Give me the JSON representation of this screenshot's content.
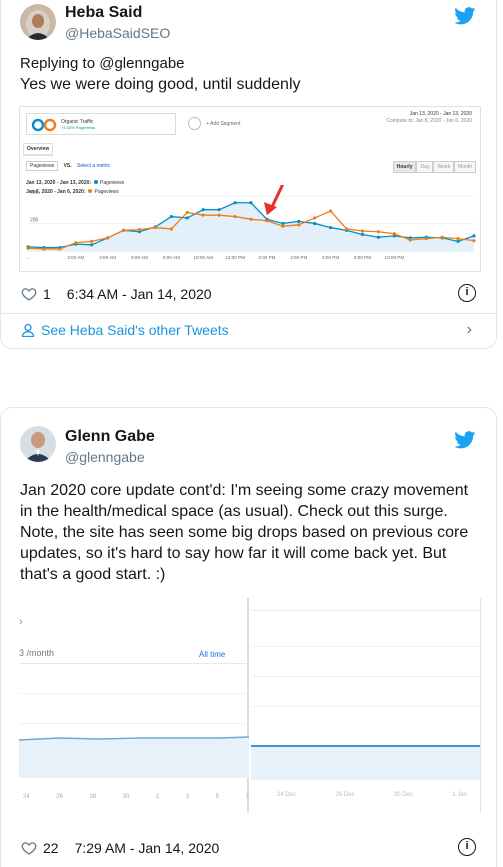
{
  "tweet1": {
    "name": "Heba Said",
    "handle": "@HebaSaidSEO",
    "replying": "Replying to @glenngabe",
    "text": "Yes we were doing good, until suddenly",
    "likes": "1",
    "time": "6:34 AM - Jan 14, 2020",
    "other_tweets": "See Heba Said's other Tweets",
    "image": {
      "segment_title": "Organic Traffic",
      "segment_sub": "+3.33% Pageviews",
      "add_segment": "+ Add Segment",
      "date_range": "Jan 13, 2020 - Jan 13, 2020",
      "compare": "Compare to: Jan 6, 2020 - Jan 6, 2020",
      "tab": "Overview",
      "metric": "Pageviews",
      "vs": "VS.",
      "select_metric": "Select a metric",
      "buttons": [
        "Hourly",
        "Day",
        "Week",
        "Month"
      ],
      "legend1_label": "Jan 13, 2020 - Jan 13, 2020:",
      "legend1_metric": "Pageviews",
      "legend2_label": "Jan 6, 2020 - Jan 6, 2020:",
      "legend2_metric": "Pageviews",
      "series1_color": "#058dc7",
      "series2_color": "#ed7e17",
      "arrow_color": "#e8312c",
      "y_ticks": [
        "400",
        "200"
      ],
      "x_ticks": [
        "...",
        "2:00 AM",
        "4:00 AM",
        "6:00 AM",
        "8:00 AM",
        "10:00 AM",
        "12:00 PM",
        "2:00 PM",
        "4:00 PM",
        "6:00 PM",
        "8:00 PM",
        "10:00 PM"
      ]
    },
    "chart_data": {
      "type": "line",
      "ylim": [
        0,
        450
      ],
      "series": [
        {
          "name": "Pageviews",
          "values": [
            30,
            25,
            25,
            50,
            45,
            95,
            150,
            140,
            175,
            250,
            240,
            300,
            300,
            350,
            350,
            230,
            200,
            215,
            200,
            170,
            150,
            120,
            100,
            110,
            95,
            100,
            95,
            70,
            110
          ]
        },
        {
          "name": "Pageviews",
          "values": [
            20,
            15,
            15,
            60,
            70,
            95,
            150,
            155,
            170,
            160,
            280,
            260,
            260,
            250,
            230,
            220,
            180,
            190,
            240,
            290,
            160,
            145,
            140,
            125,
            80,
            90,
            100,
            90,
            75
          ]
        }
      ]
    }
  },
  "tweet2": {
    "name": "Glenn Gabe",
    "handle": "@glenngabe",
    "text": "Jan 2020 core update cont'd: I'm seeing some crazy movement in the health/medical space (as usual). Check out this surge. Note, the site has seen some big drops based on previous core updates, so it's hard to say how far it will come back yet. But that's a good start. :)",
    "likes": "22",
    "time": "7:29 AM - Jan 14, 2020",
    "image": {
      "left_label": "3 /month",
      "all_time": "All time",
      "left_x_ticks": [
        "24",
        "26",
        "28",
        "30",
        "1",
        "3",
        "5",
        "7"
      ],
      "right_x_ticks": [
        "24 Dec",
        "26 Dec",
        "30 Dec",
        "1 Jan"
      ],
      "line_color": "#6aaad6",
      "line_color_dark": "#4b93c8"
    }
  }
}
